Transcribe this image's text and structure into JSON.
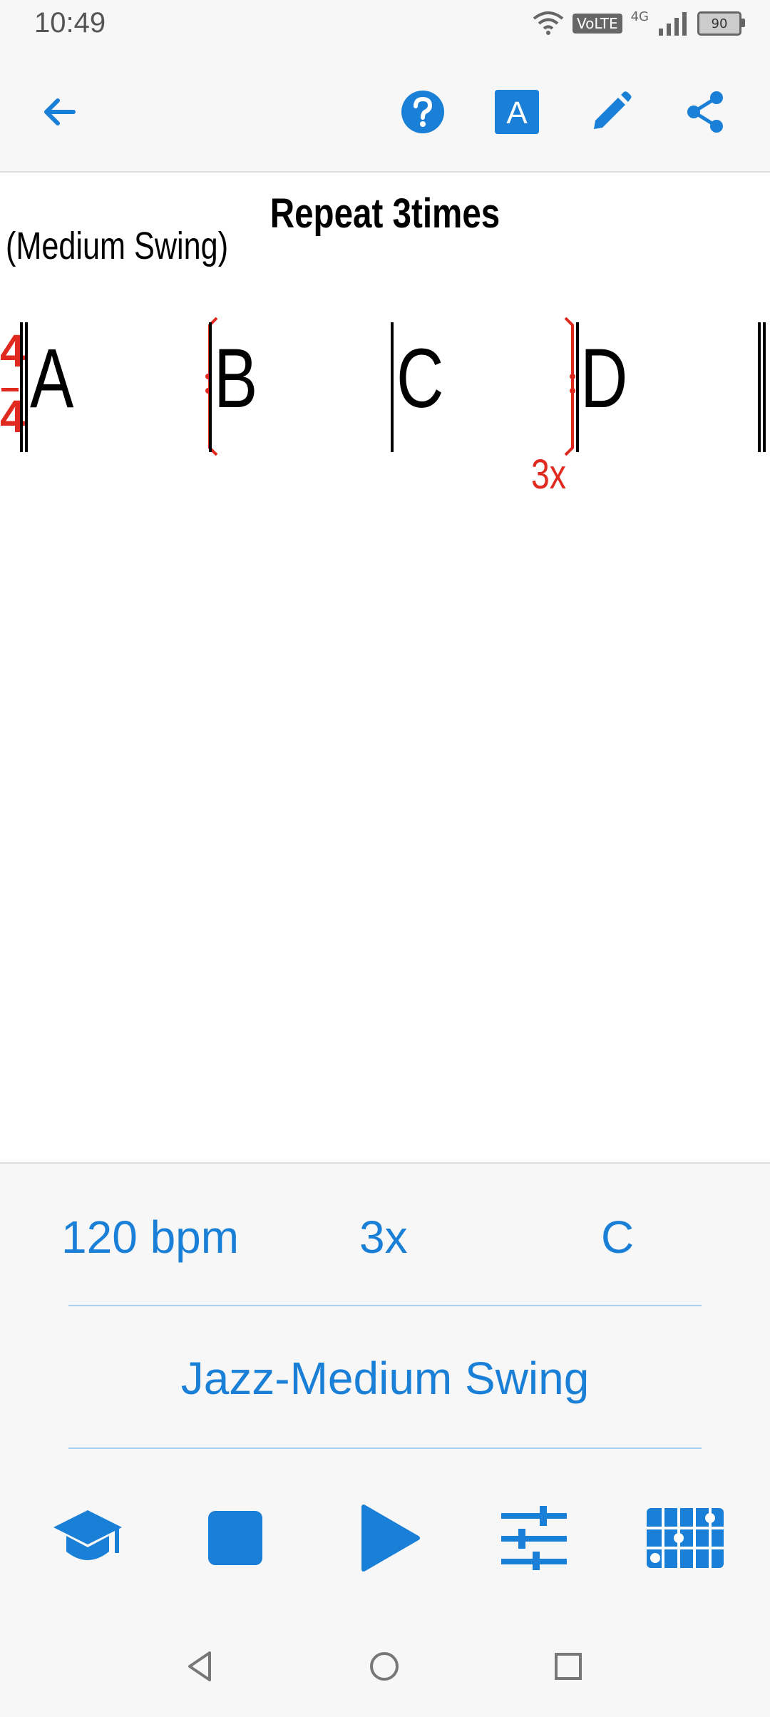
{
  "status_bar": {
    "time": "10:49",
    "volte": "VoLTE",
    "network": "4G",
    "battery": "90"
  },
  "top_bar": {
    "icons": [
      "back-arrow-icon",
      "help-icon",
      "font-icon",
      "edit-icon",
      "share-icon"
    ],
    "font_letter": "A"
  },
  "sheet": {
    "title": "Repeat 3times",
    "style": "(Medium Swing)",
    "time_signature": {
      "top": "4",
      "bottom": "4"
    },
    "measures": [
      "A",
      "B",
      "C",
      "D"
    ],
    "repeat_count": "3x"
  },
  "settings": {
    "tempo": "120 bpm",
    "repeats": "3x",
    "key": "C",
    "style": "Jazz-Medium Swing"
  },
  "controls": [
    "learn-icon",
    "stop-icon",
    "play-icon",
    "mixer-icon",
    "keyboard-icon"
  ],
  "colors": {
    "accent": "#1a7fd6",
    "repeat": "#e02a20"
  }
}
